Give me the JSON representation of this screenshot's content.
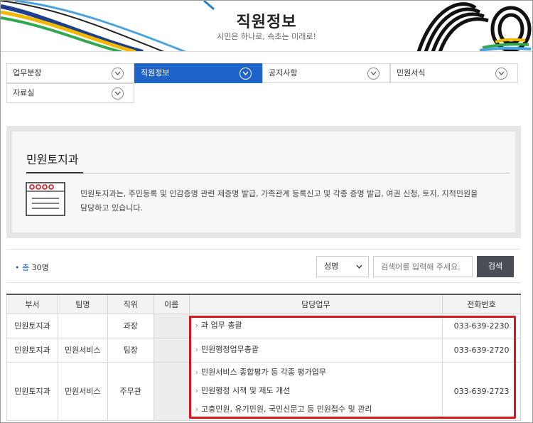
{
  "header": {
    "title": "직원정보",
    "slogan": "시민은 하나로, 속초는 미래로!"
  },
  "menu": [
    {
      "label": "업무분장",
      "active": false
    },
    {
      "label": "직원정보",
      "active": true
    },
    {
      "label": "공지사항",
      "active": false
    },
    {
      "label": "민원서식",
      "active": false
    },
    {
      "label": "자료실",
      "active": false
    }
  ],
  "department": {
    "name": "민원토지과",
    "description": "민원토지과는, 주민등록 및 인감증명 관련 제증명 발급, 가족관계 등록신고 및 각종 증명 발급, 여권 신청, 토지, 지적민원을 담당하고 있습니다."
  },
  "search": {
    "total_prefix": "• 총",
    "total_count": "30명",
    "select_value": "성명",
    "placeholder": "검색어를 입력해 주세요.",
    "button_label": "검색"
  },
  "table": {
    "headers": [
      "부서",
      "팀명",
      "직위",
      "이름",
      "담당업무",
      "전화번호"
    ],
    "rows": [
      {
        "dept": "민원토지과",
        "team": "",
        "position": "과장",
        "name": "",
        "duties": [
          "과 업무 총괄"
        ],
        "phone": "033-639-2230"
      },
      {
        "dept": "민원토지과",
        "team": "민원서비스",
        "position": "팀장",
        "name": "",
        "duties": [
          "민원행정업무총괄"
        ],
        "phone": "033-639-2720"
      },
      {
        "dept": "민원토지과",
        "team": "민원서비스",
        "position": "주무관",
        "name": "",
        "duties": [
          "민원서비스 종합평가 등 각종 평가업무",
          "민원행정 시책 및 제도 개선",
          "고충민원, 유기민원, 국민신문고 등 민원접수 및 관리"
        ],
        "phone": "033-639-2723"
      }
    ]
  },
  "colors": {
    "accent": "#1e63c7",
    "highlight": "#d8141e",
    "search_button": "#4a4f57"
  }
}
